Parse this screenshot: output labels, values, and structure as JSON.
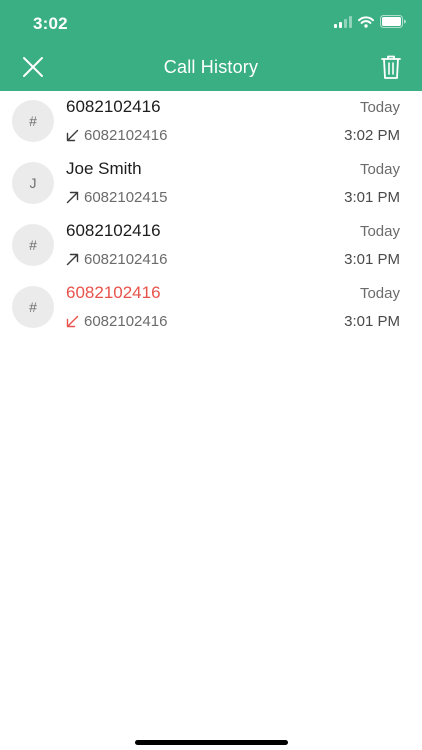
{
  "status_bar": {
    "time": "3:02",
    "icons": [
      "cellular-signal-icon",
      "wifi-icon",
      "battery-icon"
    ]
  },
  "header": {
    "title": "Call History",
    "close_icon": "close-icon",
    "delete_icon": "trash-icon"
  },
  "colors": {
    "header_bg": "#3aaf84",
    "missed": "#e8524a",
    "avatar_bg": "#ebebeb"
  },
  "calls": [
    {
      "avatar": "#",
      "name": "6082102416",
      "number": "6082102416",
      "direction": "incoming",
      "direction_icon": "incoming-call-arrow-icon",
      "missed": false,
      "day": "Today",
      "time": "3:02 PM"
    },
    {
      "avatar": "J",
      "name": "Joe Smith",
      "number": "6082102415",
      "direction": "outgoing",
      "direction_icon": "outgoing-call-arrow-icon",
      "missed": false,
      "day": "Today",
      "time": "3:01 PM"
    },
    {
      "avatar": "#",
      "name": "6082102416",
      "number": "6082102416",
      "direction": "outgoing",
      "direction_icon": "outgoing-call-arrow-icon",
      "missed": false,
      "day": "Today",
      "time": "3:01 PM"
    },
    {
      "avatar": "#",
      "name": "6082102416",
      "number": "6082102416",
      "direction": "incoming",
      "direction_icon": "missed-call-arrow-icon",
      "missed": true,
      "day": "Today",
      "time": "3:01 PM"
    }
  ]
}
